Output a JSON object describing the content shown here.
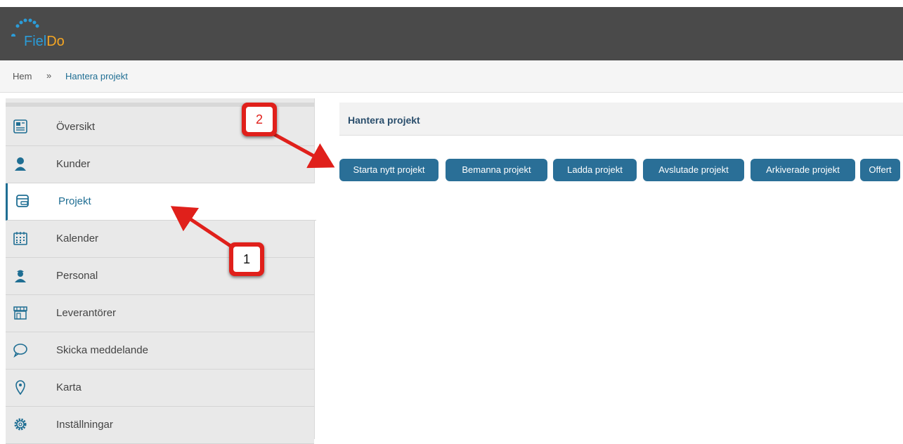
{
  "app": {
    "logo_text_left": "Fiel",
    "logo_text_right": "Do",
    "brand_blue": "#2b9cd8",
    "brand_orange": "#f5a623"
  },
  "breadcrumb": {
    "home": "Hem",
    "separator": "»",
    "current": "Hantera projekt"
  },
  "sidebar": {
    "items": [
      {
        "label": "Översikt",
        "icon": "overview-icon"
      },
      {
        "label": "Kunder",
        "icon": "customer-icon"
      },
      {
        "label": "Projekt",
        "icon": "project-icon",
        "active": true
      },
      {
        "label": "Kalender",
        "icon": "calendar-icon"
      },
      {
        "label": "Personal",
        "icon": "staff-icon"
      },
      {
        "label": "Leverantörer",
        "icon": "store-icon"
      },
      {
        "label": "Skicka meddelande",
        "icon": "chat-bubble-icon"
      },
      {
        "label": "Karta",
        "icon": "map-pin-icon"
      },
      {
        "label": "Inställningar",
        "icon": "gear-icon"
      }
    ]
  },
  "main": {
    "title": "Hantera projekt",
    "buttons": [
      "Starta nytt projekt",
      "Bemanna projekt",
      "Ladda projekt",
      "Avslutade projekt",
      "Arkiverade projekt",
      "Offert"
    ],
    "button_color": "#2a6f97"
  },
  "annotations": {
    "callout_1": "1",
    "callout_2": "2",
    "callout_color": "#e0201b"
  }
}
